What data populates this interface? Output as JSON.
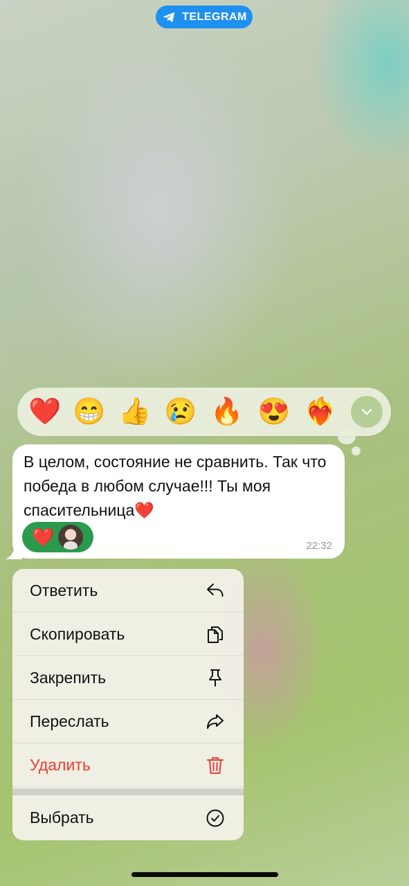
{
  "badge": {
    "label": "TELEGRAM",
    "icon": "telegram-plane-icon",
    "color": "#1e90f0"
  },
  "reactions": [
    {
      "name": "red-heart",
      "emoji": "❤️",
      "selected": true
    },
    {
      "name": "grinning-face",
      "emoji": "😁",
      "selected": false
    },
    {
      "name": "thumbs-up",
      "emoji": "👍",
      "selected": false
    },
    {
      "name": "crying-face",
      "emoji": "😢",
      "selected": false
    },
    {
      "name": "fire",
      "emoji": "🔥",
      "selected": false
    },
    {
      "name": "heart-eyes",
      "emoji": "😍",
      "selected": false
    },
    {
      "name": "heart-on-fire",
      "emoji": "❤️‍🔥",
      "selected": false
    }
  ],
  "expand_icon": "chevron-down-icon",
  "message": {
    "text": "В целом, состояние не сравнить. Так что победа в любом случае!!! Ты моя спасительница❤️",
    "time": "22:32",
    "reaction": {
      "emoji": "❤️",
      "avatar": "user-avatar"
    }
  },
  "menu": {
    "items": [
      {
        "label": "Ответить",
        "icon": "reply-icon",
        "danger": false
      },
      {
        "label": "Скопировать",
        "icon": "copy-icon",
        "danger": false
      },
      {
        "label": "Закрепить",
        "icon": "pin-icon",
        "danger": false
      },
      {
        "label": "Переслать",
        "icon": "forward-icon",
        "danger": false
      },
      {
        "label": "Удалить",
        "icon": "trash-icon",
        "danger": true
      },
      {
        "label": "Выбрать",
        "icon": "check-circle-icon",
        "danger": false
      }
    ]
  },
  "colors": {
    "danger": "#ec3b36",
    "reaction_chip": "#2a9a4e",
    "bubble": "#ffffff"
  }
}
